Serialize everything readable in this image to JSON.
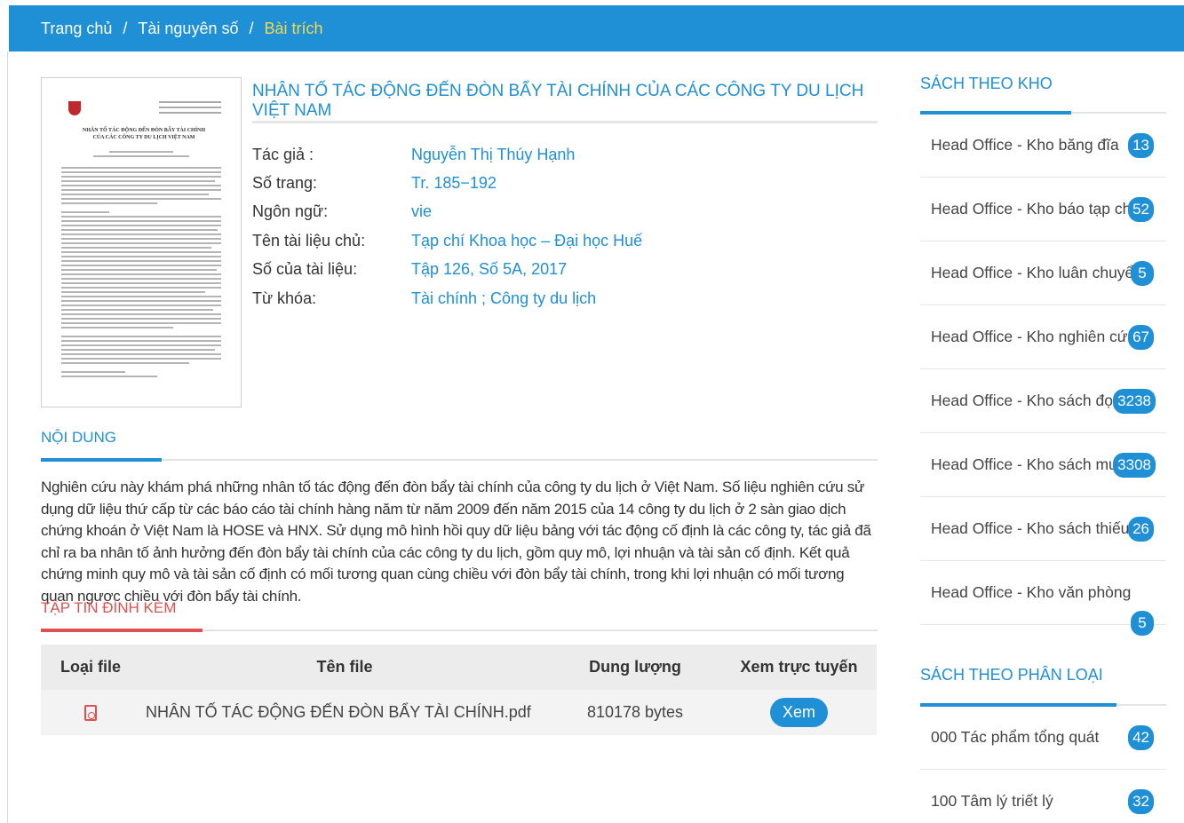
{
  "breadcrumb": {
    "home": "Trang chủ",
    "level2": "Tài nguyên số",
    "current": "Bài trích",
    "separator": "/"
  },
  "cover": {
    "title": "NHÂN TỐ TÁC ĐỘNG ĐẾN ĐÒN BẨY TÀI CHÍNH CỦA CÁC CÔNG TY DU LỊCH VIỆT NAM",
    "accent_color": "#c0282d"
  },
  "article": {
    "title": "NHÂN TỐ TÁC ĐỘNG ĐẾN ĐÒN BẨY TÀI CHÍNH CỦA CÁC CÔNG TY DU LỊCH VIỆT NAM",
    "meta": [
      {
        "label": "Tác giả :",
        "value": "Nguyễn Thị Thúy Hạnh"
      },
      {
        "label": "Số trang:",
        "value": "Tr. 185−192"
      },
      {
        "label": "Ngôn ngữ:",
        "value": "vie"
      },
      {
        "label": "Tên tài liệu chủ:",
        "value": "Tạp chí Khoa học – Đại học Huế"
      },
      {
        "label": "Số của tài liệu:",
        "value": "Tập 126, Số 5A, 2017"
      },
      {
        "label": "Từ khóa:",
        "value": "Tài chính ; Công ty du lịch"
      }
    ]
  },
  "content": {
    "heading": "NỘI DUNG",
    "text": "Nghiên cứu này khám phá những nhân tố tác động đến đòn bẩy tài chính của công ty du lịch ở Việt Nam. Số liệu nghiên cứu sử dụng dữ liệu thứ cấp từ các báo cáo tài chính hàng năm từ năm 2009 đến năm 2015 của 14 công ty du lịch ở 2 sàn giao dịch chứng khoán ở Việt Nam là HOSE và HNX. Sử dụng mô hình hồi quy dữ liệu bảng với tác động cố định là các công ty, tác giả đã chỉ ra ba nhân tố ảnh hưởng đến đòn bẩy tài chính của các công ty du lịch, gồm quy mô, lợi nhuận và tài sản cố định. Kết quả chứng minh quy mô và tài sản cố định có mối tương quan cùng chiều với đòn bẩy tài chính, trong khi lợi nhuận có mối tương quan ngược chiều với đòn bẩy tài chính."
  },
  "attachments": {
    "heading": "TẬP TIN ĐÍNH KÈM",
    "columns": [
      "Loại file",
      "Tên file",
      "Dung lượng",
      "Xem trực tuyến"
    ],
    "rows": [
      {
        "type_icon": "pdf-icon",
        "name": "NHÂN TỐ TÁC ĐỘNG ĐẾN ĐÒN BẨY TÀI CHÍNH.pdf",
        "size": "810178 bytes",
        "action": "Xem"
      }
    ]
  },
  "sidebar": {
    "by_store": {
      "heading": "SÁCH THEO KHO",
      "items": [
        {
          "label": "Head Office - Kho băng đĩa",
          "count": "13"
        },
        {
          "label": "Head Office - Kho báo tạp chí",
          "count": "52"
        },
        {
          "label": "Head Office - Kho luân chuyển",
          "count": "5"
        },
        {
          "label": "Head Office - Kho nghiên cứu",
          "count": "67"
        },
        {
          "label": "Head Office - Kho sách đọc",
          "count": "3238"
        },
        {
          "label": "Head Office - Kho sách mượn",
          "count": "3308"
        },
        {
          "label": "Head Office - Kho sách thiếu nhi",
          "count": "26"
        },
        {
          "label": "Head Office - Kho văn phòng phẩm",
          "count": "5"
        }
      ]
    },
    "by_category": {
      "heading": "SÁCH THEO PHÂN LOẠI",
      "items": [
        {
          "label": "000 Tác phẩm tổng quát",
          "count": "42"
        },
        {
          "label": "100 Tâm lý triết lý",
          "count": "32"
        }
      ]
    }
  },
  "colors": {
    "primary": "#1f8fd6",
    "breadcrumb_current": "#f5d94a",
    "attachment_accent": "#e05050"
  }
}
